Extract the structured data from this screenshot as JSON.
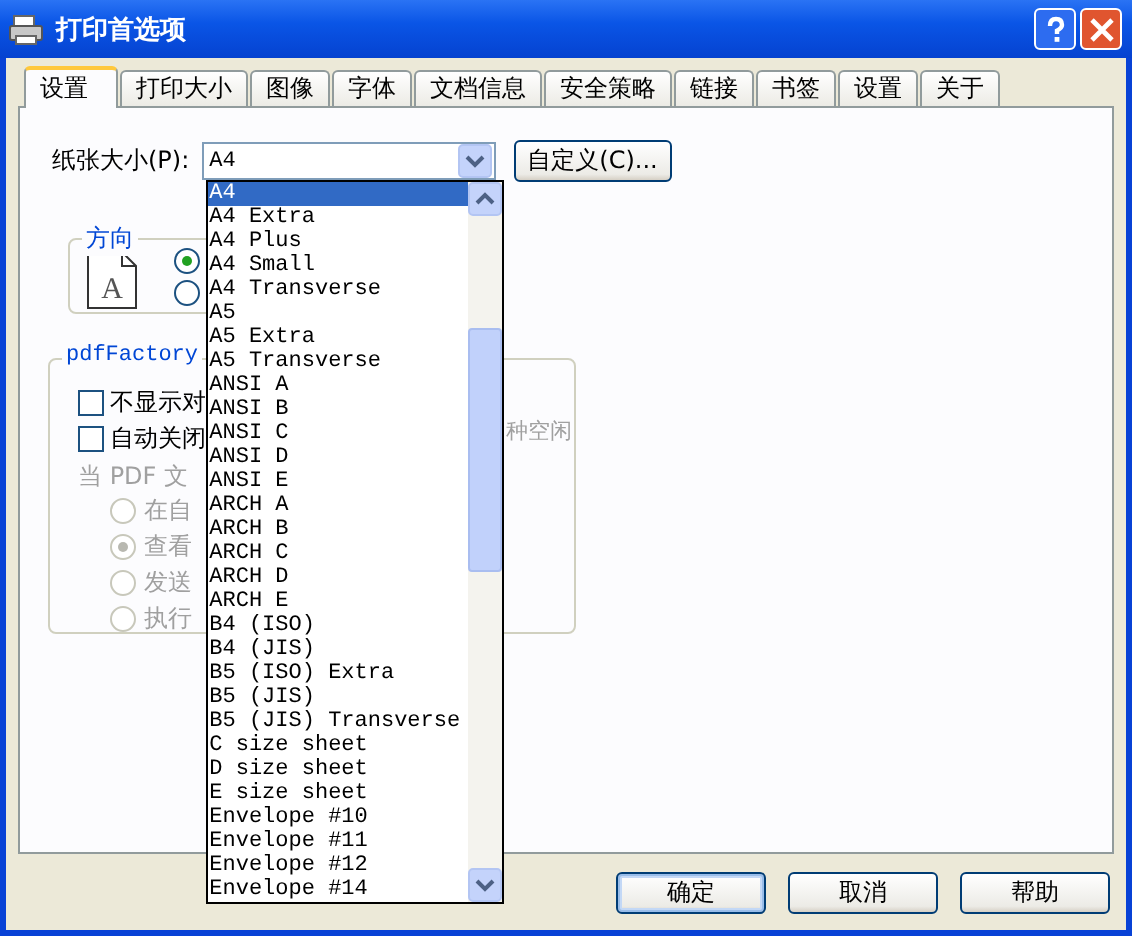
{
  "window": {
    "title": "打印首选项"
  },
  "tabs": [
    {
      "label": "设置",
      "selected": true
    },
    {
      "label": "打印大小",
      "selected": false
    },
    {
      "label": "图像",
      "selected": false
    },
    {
      "label": "字体",
      "selected": false
    },
    {
      "label": "文档信息",
      "selected": false
    },
    {
      "label": "安全策略",
      "selected": false
    },
    {
      "label": "链接",
      "selected": false
    },
    {
      "label": "书签",
      "selected": false
    },
    {
      "label": "设置",
      "selected": false
    },
    {
      "label": "关于",
      "selected": false
    }
  ],
  "paper_size": {
    "label": "纸张大小(P):",
    "value": "A4",
    "custom_button": "自定义(C)..."
  },
  "orientation": {
    "legend": "方向",
    "page_letter": "A",
    "options": [
      {
        "selected": true
      },
      {
        "selected": false
      }
    ]
  },
  "pdf_group": {
    "legend": "pdfFactory",
    "checkboxes": [
      {
        "label": "不显示对",
        "checked": false
      },
      {
        "label": "自动关闭",
        "checked": false
      }
    ],
    "note": "种空闲",
    "when_label": "当 PDF 文",
    "actions": [
      {
        "label": "在自",
        "selected": false,
        "disabled": true
      },
      {
        "label": "查看",
        "selected": true,
        "disabled": true
      },
      {
        "label": "发送",
        "selected": false,
        "disabled": true
      },
      {
        "label": "执行",
        "selected": false,
        "disabled": true
      }
    ]
  },
  "dropdown": {
    "items": [
      {
        "label": "A4",
        "selected": true
      },
      {
        "label": "A4 Extra",
        "selected": false
      },
      {
        "label": "A4 Plus",
        "selected": false
      },
      {
        "label": "A4 Small",
        "selected": false
      },
      {
        "label": "A4 Transverse",
        "selected": false
      },
      {
        "label": "A5",
        "selected": false
      },
      {
        "label": "A5 Extra",
        "selected": false
      },
      {
        "label": "A5 Transverse",
        "selected": false
      },
      {
        "label": "ANSI A",
        "selected": false
      },
      {
        "label": "ANSI B",
        "selected": false
      },
      {
        "label": "ANSI C",
        "selected": false
      },
      {
        "label": "ANSI D",
        "selected": false
      },
      {
        "label": "ANSI E",
        "selected": false
      },
      {
        "label": "ARCH A",
        "selected": false
      },
      {
        "label": "ARCH B",
        "selected": false
      },
      {
        "label": "ARCH C",
        "selected": false
      },
      {
        "label": "ARCH D",
        "selected": false
      },
      {
        "label": "ARCH E",
        "selected": false
      },
      {
        "label": "B4 (ISO)",
        "selected": false
      },
      {
        "label": "B4 (JIS)",
        "selected": false
      },
      {
        "label": "B5 (ISO) Extra",
        "selected": false
      },
      {
        "label": "B5 (JIS)",
        "selected": false
      },
      {
        "label": "B5 (JIS) Transverse",
        "selected": false
      },
      {
        "label": "C size sheet",
        "selected": false
      },
      {
        "label": "D size sheet",
        "selected": false
      },
      {
        "label": "E size sheet",
        "selected": false
      },
      {
        "label": "Envelope #10",
        "selected": false
      },
      {
        "label": "Envelope #11",
        "selected": false
      },
      {
        "label": "Envelope #12",
        "selected": false
      },
      {
        "label": "Envelope #14",
        "selected": false
      }
    ]
  },
  "buttons": [
    {
      "label": "确定",
      "default": true
    },
    {
      "label": "取消",
      "default": false
    },
    {
      "label": "帮助",
      "default": false
    }
  ]
}
